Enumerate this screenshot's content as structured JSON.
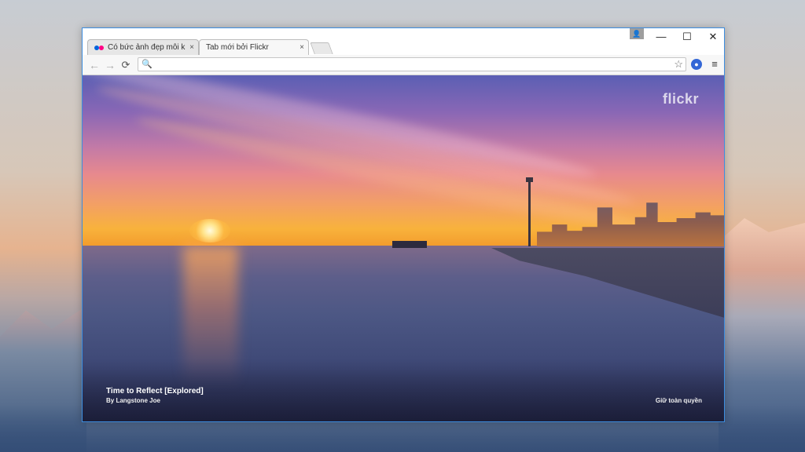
{
  "tabs": [
    {
      "title": "Có bức ảnh đẹp mỗi khi b",
      "close": "×"
    },
    {
      "title": "Tab mới bởi Flickr",
      "close": "×"
    }
  ],
  "window_controls": {
    "minimize": "—",
    "maximize": "☐",
    "close": "✕",
    "user": "👤"
  },
  "nav": {
    "back": "←",
    "forward": "→",
    "reload": "⟳"
  },
  "omnibox": {
    "value": "",
    "placeholder": "",
    "search_icon": "🔍",
    "star_icon": "☆"
  },
  "toolbar": {
    "extension_icon": "●",
    "menu_icon": "≡"
  },
  "page": {
    "logo": "flickr",
    "photo_title": "Time to Reflect [Explored]",
    "photo_author": "By Langstone Joe",
    "rights_link": "Giữ toàn quyền"
  },
  "colors": {
    "window_border": "#3d8ee0",
    "flickr_blue": "#0063dc",
    "flickr_pink": "#ff0084"
  }
}
